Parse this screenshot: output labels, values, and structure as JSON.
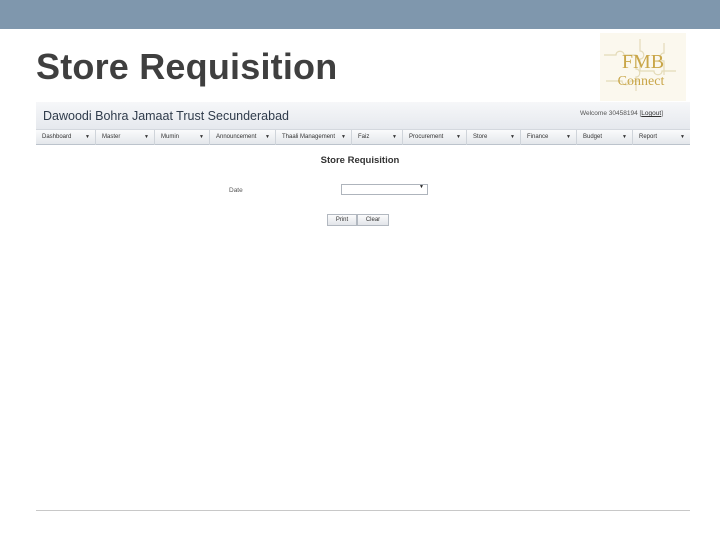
{
  "slide": {
    "title": "Store Requisition"
  },
  "logo": {
    "line1": "FMB",
    "line2": "Connect"
  },
  "app": {
    "title": "Dawoodi Bohra Jamaat Trust Secunderabad",
    "welcome_prefix": "Welcome 30458194 [",
    "logout": "Logout",
    "welcome_suffix": "]"
  },
  "nav": [
    {
      "label": "Dashboard"
    },
    {
      "label": "Master"
    },
    {
      "label": "Mumin"
    },
    {
      "label": "Announcement"
    },
    {
      "label": "Thaali Management"
    },
    {
      "label": "Faiz"
    },
    {
      "label": "Procurement"
    },
    {
      "label": "Store"
    },
    {
      "label": "Finance"
    },
    {
      "label": "Budget"
    },
    {
      "label": "Report"
    }
  ],
  "form": {
    "title": "Store Requisition",
    "date_label": "Date",
    "date_value": "",
    "print_label": "Print",
    "clear_label": "Clear"
  },
  "icons": {
    "caret": "dropdown-caret-icon"
  },
  "colors": {
    "top_band": "#7f97ad",
    "title": "#3f3f3f",
    "logo_text": "#c9a648"
  }
}
